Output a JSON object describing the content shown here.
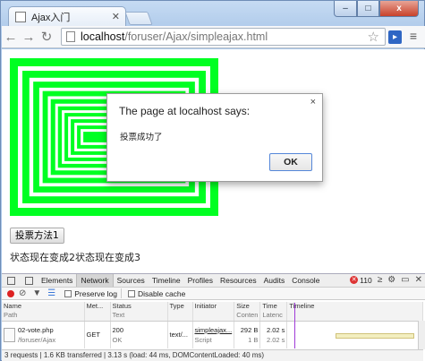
{
  "browser": {
    "tab_title": "Ajax入门",
    "url_host": "localhost",
    "url_path": "/foruser/Ajax/simpleajax.html",
    "window_buttons": {
      "minimize": "–",
      "maximize": "□",
      "close": "x"
    }
  },
  "page": {
    "vote_button": "投票方法1",
    "status_text": "状态现在变成2状态现在变成3",
    "graphic_colors": {
      "fill": "#00ff22",
      "gap": "#ffffff"
    }
  },
  "dialog": {
    "title": "The page at localhost says:",
    "message": "投票成功了",
    "ok_label": "OK",
    "close_glyph": "×"
  },
  "devtools": {
    "tabs": [
      "Elements",
      "Network",
      "Sources",
      "Timeline",
      "Profiles",
      "Resources",
      "Audits",
      "Console"
    ],
    "active_tab": "Network",
    "error_count": "110",
    "preserve_log": "Preserve log",
    "disable_cache": "Disable cache",
    "columns": [
      {
        "name": "Name",
        "sub": "Path"
      },
      {
        "name": "Met...",
        "sub": ""
      },
      {
        "name": "Status",
        "sub": "Text"
      },
      {
        "name": "Type",
        "sub": ""
      },
      {
        "name": "Initiator",
        "sub": ""
      },
      {
        "name": "Size",
        "sub": "Conten"
      },
      {
        "name": "Time",
        "sub": "Latenc"
      },
      {
        "name": "Timeline",
        "sub": ""
      }
    ],
    "row": {
      "name": "02-vote.php",
      "path": "/foruser/Ajax",
      "method": "GET",
      "status": "200",
      "status_text": "OK",
      "type": "text/...",
      "initiator": "simpleajax...",
      "initiator_sub": "Script",
      "size": "292 B",
      "content": "1 B",
      "time": "2.02 s",
      "latency": "2.02 s"
    },
    "summary": "3 requests | 1.6 KB transferred | 3.13 s (load: 44 ms, DOMContentLoaded: 40 ms)"
  }
}
